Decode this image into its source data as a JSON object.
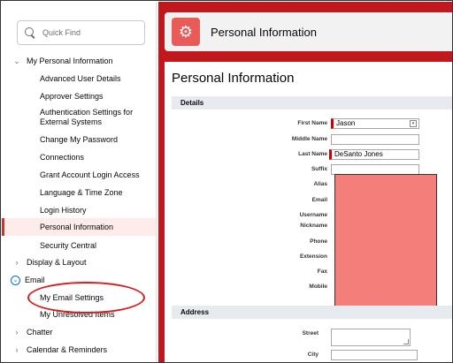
{
  "sidebar": {
    "search": {
      "placeholder": "Quick Find"
    },
    "sections": [
      {
        "label": "My Personal Information",
        "expanded": true
      },
      {
        "label": "Display & Layout",
        "expanded": false
      },
      {
        "label": "Email",
        "expanded": true
      },
      {
        "label": "Chatter",
        "expanded": false
      },
      {
        "label": "Calendar & Reminders",
        "expanded": false
      }
    ],
    "personal_items": [
      "Advanced User Details",
      "Approver Settings",
      "Authentication Settings for External Systems",
      "Change My Password",
      "Connections",
      "Grant Account Login Access",
      "Language & Time Zone",
      "Login History",
      "Personal Information",
      "Security Central"
    ],
    "email_items": [
      "My Email Settings",
      "My Unresolved Items"
    ],
    "active_item": "Personal Information",
    "highlight_color": "#d71c1c"
  },
  "header": {
    "title": "Personal Information",
    "icon": "gear-icon",
    "accent": "#e85b56"
  },
  "main": {
    "title": "Personal Information",
    "details_section": "Details",
    "address_section": "Address",
    "fields": {
      "first_name": {
        "label": "First Name",
        "value": "Jason"
      },
      "middle_name": {
        "label": "Middle Name",
        "value": ""
      },
      "last_name": {
        "label": "Last Name",
        "value": "DeSanto Jones"
      },
      "suffix": {
        "label": "Suffix",
        "value": ""
      },
      "alias": {
        "label": "Alias"
      },
      "email": {
        "label": "Email"
      },
      "username": {
        "label": "Username"
      },
      "nickname": {
        "label": "Nickname"
      },
      "phone": {
        "label": "Phone"
      },
      "extension": {
        "label": "Extension"
      },
      "fax": {
        "label": "Fax"
      },
      "mobile": {
        "label": "Mobile"
      },
      "street": {
        "label": "Street"
      },
      "city": {
        "label": "City"
      }
    },
    "brand_color": "#c1181e"
  }
}
